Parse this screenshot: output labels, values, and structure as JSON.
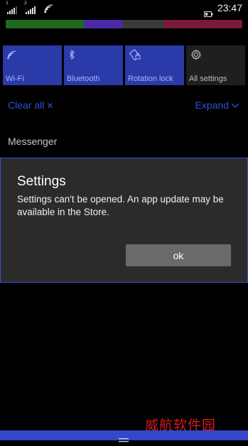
{
  "status_bar": {
    "sim1_label": "1",
    "sim2_label": "2",
    "time": "23:47",
    "icons": [
      "signal-bars-sim1-icon",
      "signal-bars-sim2-icon",
      "wifi-icon",
      "battery-icon"
    ]
  },
  "color_strip": {
    "segments": [
      "#1f6a1f",
      "#4a2aa8",
      "#3a3a3a",
      "#7a1a3a"
    ]
  },
  "quick_actions": {
    "tiles": [
      {
        "label": "Wi-Fi",
        "icon": "wifi-icon",
        "state": "on"
      },
      {
        "label": "Bluetooth",
        "icon": "bluetooth-icon",
        "state": "on"
      },
      {
        "label": "Rotation lock",
        "icon": "rotation-lock-icon",
        "state": "on"
      },
      {
        "label": "All settings",
        "icon": "gear-icon",
        "state": "off"
      }
    ]
  },
  "action_center": {
    "clear_all_label": "Clear all",
    "expand_label": "Expand"
  },
  "notifications": {
    "group_title": "Messenger"
  },
  "dialog": {
    "title": "Settings",
    "message": "Settings can't be opened. An app update may be available in the Store.",
    "ok_label": "ok"
  },
  "watermark": {
    "text": "威航软件园"
  },
  "colors": {
    "accent": "#2f4fd8",
    "tile_on": "#2a3aa8",
    "dialog_bg": "#2b2b2b",
    "dialog_border": "#3a52d8",
    "button_bg": "#6a6a6a",
    "watermark": "#d71a1a"
  }
}
